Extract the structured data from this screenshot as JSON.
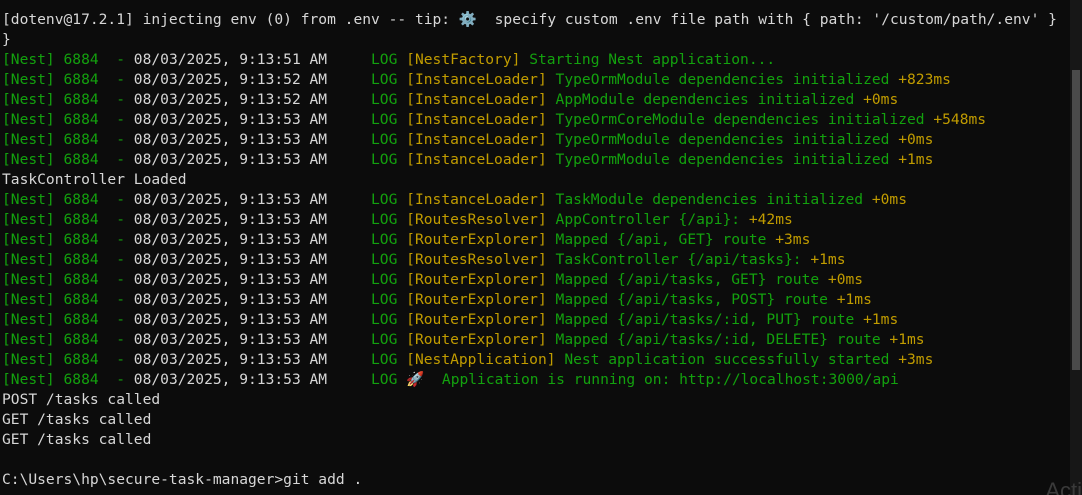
{
  "lines": [
    {
      "type": "plain",
      "text": "[dotenv@17.2.1] injecting env (0) from .env -- tip: ⚙️  specify custom .env file path with { path: '/custom/path/.env' }"
    },
    {
      "type": "plain",
      "text": "}"
    },
    {
      "type": "nest",
      "pid": "[Nest] 6884  -",
      "timestamp": "08/03/2025, 9:13:51 AM",
      "level": "LOG",
      "context": "[NestFactory]",
      "message": "Starting Nest application...",
      "delta": ""
    },
    {
      "type": "nest",
      "pid": "[Nest] 6884  -",
      "timestamp": "08/03/2025, 9:13:52 AM",
      "level": "LOG",
      "context": "[InstanceLoader]",
      "message": "TypeOrmModule dependencies initialized",
      "delta": "+823ms"
    },
    {
      "type": "nest",
      "pid": "[Nest] 6884  -",
      "timestamp": "08/03/2025, 9:13:52 AM",
      "level": "LOG",
      "context": "[InstanceLoader]",
      "message": "AppModule dependencies initialized",
      "delta": "+0ms"
    },
    {
      "type": "nest",
      "pid": "[Nest] 6884  -",
      "timestamp": "08/03/2025, 9:13:53 AM",
      "level": "LOG",
      "context": "[InstanceLoader]",
      "message": "TypeOrmCoreModule dependencies initialized",
      "delta": "+548ms"
    },
    {
      "type": "nest",
      "pid": "[Nest] 6884  -",
      "timestamp": "08/03/2025, 9:13:53 AM",
      "level": "LOG",
      "context": "[InstanceLoader]",
      "message": "TypeOrmModule dependencies initialized",
      "delta": "+0ms"
    },
    {
      "type": "nest",
      "pid": "[Nest] 6884  -",
      "timestamp": "08/03/2025, 9:13:53 AM",
      "level": "LOG",
      "context": "[InstanceLoader]",
      "message": "TypeOrmModule dependencies initialized",
      "delta": "+1ms"
    },
    {
      "type": "plain",
      "text": "TaskController Loaded"
    },
    {
      "type": "nest",
      "pid": "[Nest] 6884  -",
      "timestamp": "08/03/2025, 9:13:53 AM",
      "level": "LOG",
      "context": "[InstanceLoader]",
      "message": "TaskModule dependencies initialized",
      "delta": "+0ms"
    },
    {
      "type": "nest",
      "pid": "[Nest] 6884  -",
      "timestamp": "08/03/2025, 9:13:53 AM",
      "level": "LOG",
      "context": "[RoutesResolver]",
      "message": "AppController {/api}:",
      "delta": "+42ms"
    },
    {
      "type": "nest",
      "pid": "[Nest] 6884  -",
      "timestamp": "08/03/2025, 9:13:53 AM",
      "level": "LOG",
      "context": "[RouterExplorer]",
      "message": "Mapped {/api, GET} route",
      "delta": "+3ms"
    },
    {
      "type": "nest",
      "pid": "[Nest] 6884  -",
      "timestamp": "08/03/2025, 9:13:53 AM",
      "level": "LOG",
      "context": "[RoutesResolver]",
      "message": "TaskController {/api/tasks}:",
      "delta": "+1ms"
    },
    {
      "type": "nest",
      "pid": "[Nest] 6884  -",
      "timestamp": "08/03/2025, 9:13:53 AM",
      "level": "LOG",
      "context": "[RouterExplorer]",
      "message": "Mapped {/api/tasks, GET} route",
      "delta": "+0ms"
    },
    {
      "type": "nest",
      "pid": "[Nest] 6884  -",
      "timestamp": "08/03/2025, 9:13:53 AM",
      "level": "LOG",
      "context": "[RouterExplorer]",
      "message": "Mapped {/api/tasks, POST} route",
      "delta": "+1ms"
    },
    {
      "type": "nest",
      "pid": "[Nest] 6884  -",
      "timestamp": "08/03/2025, 9:13:53 AM",
      "level": "LOG",
      "context": "[RouterExplorer]",
      "message": "Mapped {/api/tasks/:id, PUT} route",
      "delta": "+1ms"
    },
    {
      "type": "nest",
      "pid": "[Nest] 6884  -",
      "timestamp": "08/03/2025, 9:13:53 AM",
      "level": "LOG",
      "context": "[RouterExplorer]",
      "message": "Mapped {/api/tasks/:id, DELETE} route",
      "delta": "+1ms"
    },
    {
      "type": "nest",
      "pid": "[Nest] 6884  -",
      "timestamp": "08/03/2025, 9:13:53 AM",
      "level": "LOG",
      "context": "[NestApplication]",
      "message": "Nest application successfully started",
      "delta": "+3ms"
    },
    {
      "type": "nest",
      "pid": "[Nest] 6884  -",
      "timestamp": "08/03/2025, 9:13:53 AM",
      "level": "LOG",
      "context": "🚀",
      "message": " Application is running on: http://localhost:3000/api",
      "delta": ""
    },
    {
      "type": "plain",
      "text": "POST /tasks called"
    },
    {
      "type": "plain",
      "text": "GET /tasks called"
    },
    {
      "type": "plain",
      "text": "GET /tasks called"
    },
    {
      "type": "plain",
      "text": ""
    },
    {
      "type": "prompt",
      "text": "C:\\Users\\hp\\secure-task-manager>git add ."
    }
  ],
  "watermark": "Acti",
  "colors": {
    "background": "#0c0c0c",
    "text": "#d7d7d7",
    "green": "#13a10e",
    "yellow": "#c19c00"
  }
}
